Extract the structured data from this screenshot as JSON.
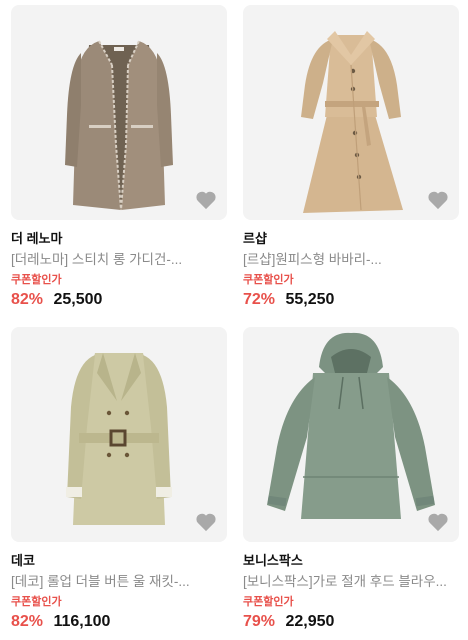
{
  "products": [
    {
      "brand": "더 레노마",
      "name": "[더레노마] 스티치 롱 가디건-...",
      "coupon_label": "쿠폰할인가",
      "discount": "82%",
      "price": "25,500",
      "image": "long-cardigan-image"
    },
    {
      "brand": "르샵",
      "name": "[르샵]원피스형 바바리-...",
      "coupon_label": "쿠폰할인가",
      "discount": "72%",
      "price": "55,250",
      "image": "trench-dress-image"
    },
    {
      "brand": "데코",
      "name": "[데코] 롤업 더블 버튼 울 재킷-...",
      "coupon_label": "쿠폰할인가",
      "discount": "82%",
      "price": "116,100",
      "image": "belted-wool-jacket-image"
    },
    {
      "brand": "보니스팍스",
      "name": "[보니스팍스]가로 절개 후드 블라우...",
      "coupon_label": "쿠폰할인가",
      "discount": "79%",
      "price": "22,950",
      "image": "hooded-blouse-image"
    }
  ],
  "colors": {
    "discount": "#e8514b",
    "thumb_bg": "#f3f3f3",
    "heart": "#a9a9a9"
  }
}
